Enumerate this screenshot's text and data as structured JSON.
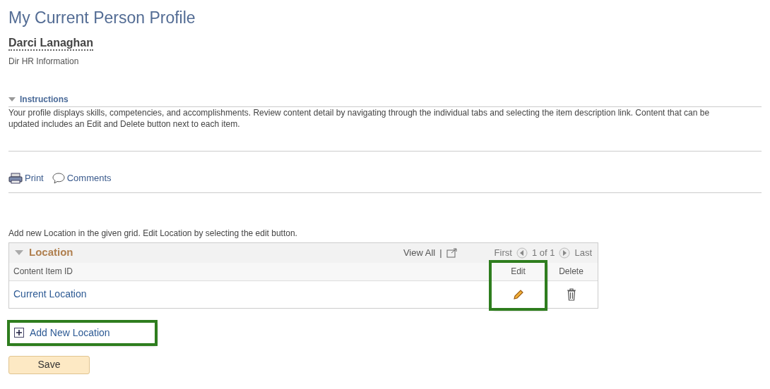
{
  "page_title": "My Current Person Profile",
  "person": {
    "name": "Darci Lanaghan",
    "job_title": "Dir HR Information"
  },
  "instructions": {
    "title": "Instructions",
    "expanded": true,
    "text": "Your profile displays skills, competencies, and accomplishments. Review content detail by navigating through the individual tabs and selecting the item description link. Content that can be updated includes an Edit and Delete button next to each item."
  },
  "actions": [
    {
      "kind": "print",
      "label": "Print"
    },
    {
      "kind": "comments",
      "label": "Comments"
    }
  ],
  "grid_caption": "Add new Location in the given grid. Edit Location by selecting the edit button.",
  "grid": {
    "title": "Location",
    "expanded": true,
    "view_all": "View All",
    "separator": "|",
    "first": "First",
    "page": "1 of 1",
    "last": "Last",
    "columns": [
      {
        "label": "Content Item ID",
        "highlighted": false
      },
      {
        "label": "Edit",
        "highlighted": true
      },
      {
        "label": "Delete",
        "highlighted": false
      }
    ],
    "rows": [
      {
        "item": "Current Location"
      }
    ]
  },
  "add_link": {
    "label": "Add New Location",
    "highlighted": true
  },
  "save_button": "Save"
}
